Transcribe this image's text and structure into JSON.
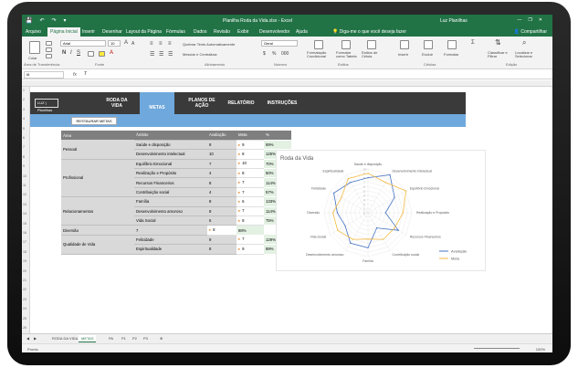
{
  "window": {
    "title": "Planilha Roda da Vida.xlsx - Excel",
    "user": "Luz Planilhas",
    "controls": [
      "—",
      "❐",
      "✕"
    ],
    "qat": [
      "💾",
      "↶",
      "↷",
      "▾"
    ]
  },
  "ribbon_tabs": [
    {
      "label": "Arquivo",
      "active": false
    },
    {
      "label": "Página Inicial",
      "active": true
    },
    {
      "label": "Inserir",
      "active": false
    },
    {
      "label": "Desenhar",
      "active": false
    },
    {
      "label": "Layout da Página",
      "active": false
    },
    {
      "label": "Fórmulas",
      "active": false
    },
    {
      "label": "Dados",
      "active": false
    },
    {
      "label": "Revisão",
      "active": false
    },
    {
      "label": "Exibir",
      "active": false
    },
    {
      "label": "Desenvolvedor",
      "active": false
    },
    {
      "label": "Ajuda",
      "active": false
    }
  ],
  "tell_me": "Diga-me o que você deseja fazer",
  "share": "Compartilhar",
  "ribbon": {
    "groups": [
      "Área de Transferência",
      "Fonte",
      "Alinhamento",
      "Número",
      "Estilos",
      "Células",
      "Edição"
    ],
    "font_name": "Arial",
    "font_size": "10",
    "paste": "Colar",
    "wrap": "Quebrar Texto Automaticamente",
    "merge": "Mesclar e Centralizar",
    "number_format": "Geral",
    "cond_format": "Formatação Condicional",
    "format_table": "Formatar como Tabela",
    "cell_styles": "Estilos de Célula",
    "insert": "Inserir",
    "delete": "Excluir",
    "format": "Formatar",
    "sort": "Classificar e Filtrar",
    "find": "Localizar e Selecionar"
  },
  "formula_bar": {
    "name_box": "I6",
    "fx": "fx",
    "value": "7"
  },
  "app": {
    "logo": "LUZ | Planilhas",
    "nav": [
      {
        "label": "RODA DA VIDA",
        "active": false
      },
      {
        "label": "METAS",
        "active": true
      },
      {
        "label": "PLANOS DE AÇÃO",
        "active": false
      },
      {
        "label": "RELATÓRIO",
        "active": false
      },
      {
        "label": "INSTRUÇÕES",
        "active": false
      }
    ],
    "reset_button": "RESTAURAR METAS"
  },
  "table": {
    "headers": [
      "Área",
      "Âmbito",
      "Avaliação",
      "Meta",
      "%"
    ],
    "areas": [
      "Pessoal",
      "Profissional",
      "Relacionamentos",
      "Qualidade de Vida"
    ],
    "rows": [
      {
        "ambito": "Saúde e disposição",
        "avaliacao": "8",
        "meta": "9",
        "pct": "89%"
      },
      {
        "ambito": "Desenvolvimento intelectual",
        "avaliacao": "10",
        "meta": "8",
        "pct": "125%"
      },
      {
        "ambito": "Equilíbrio Emocional",
        "avaliacao": "7",
        "meta": "10",
        "pct": "70%"
      },
      {
        "ambito": "Realização e Propósito",
        "avaliacao": "4",
        "meta": "8",
        "pct": "50%"
      },
      {
        "ambito": "Recursos Financeiros",
        "avaliacao": "8",
        "meta": "7",
        "pct": "114%"
      },
      {
        "ambito": "Contribuição social",
        "avaliacao": "4",
        "meta": "7",
        "pct": "57%"
      },
      {
        "ambito": "Família",
        "avaliacao": "8",
        "meta": "6",
        "pct": "133%"
      },
      {
        "ambito": "Desenvolvimento amoroso",
        "avaliacao": "8",
        "meta": "7",
        "pct": "114%"
      },
      {
        "ambito": "Vida Social",
        "avaliacao": "6",
        "meta": "8",
        "pct": "75%"
      },
      {
        "ambito": "Diversão",
        "avaliacao": "7",
        "meta": "8",
        "pct": "88%"
      },
      {
        "ambito": "Felicidade",
        "avaliacao": "9",
        "meta": "7",
        "pct": "129%"
      },
      {
        "ambito": "Espiritualidade",
        "avaliacao": "8",
        "meta": "9",
        "pct": "89%"
      }
    ]
  },
  "chart_data": {
    "type": "radar",
    "title": "Roda da Vida",
    "categories": [
      "Saúde e disposição",
      "Desenvolvimento intelectual",
      "Equilíbrio Emocional",
      "Realização e Propósito",
      "Recursos Financeiros",
      "Contribuição social",
      "Família",
      "Desenvolvimento amoroso",
      "Vida Social",
      "Diversão",
      "Felicidade",
      "Espiritualidade"
    ],
    "series": [
      {
        "name": "Avaliação",
        "values": [
          8,
          10,
          7,
          4,
          8,
          4,
          8,
          8,
          6,
          7,
          9,
          8
        ],
        "color": "#4472c4"
      },
      {
        "name": "Meta",
        "values": [
          9,
          8,
          10,
          8,
          7,
          7,
          6,
          7,
          8,
          8,
          7,
          9
        ],
        "color": "#f4b942"
      }
    ],
    "rlim": [
      0,
      10
    ],
    "ticks": [
      "0",
      "1",
      "2",
      "3",
      "4",
      "5",
      "6",
      "7",
      "8",
      "9",
      "10"
    ],
    "legend_position": "bottom-right"
  },
  "sheet_tabs": [
    {
      "label": "RODA DA VIDA",
      "active": false
    },
    {
      "label": "METAS",
      "active": true
    },
    {
      "label": "PA",
      "active": false
    },
    {
      "label": "P1",
      "active": false
    },
    {
      "label": "P2",
      "active": false
    },
    {
      "label": "P3",
      "active": false
    }
  ],
  "status": {
    "ready": "Pronto",
    "zoom": "100%"
  }
}
